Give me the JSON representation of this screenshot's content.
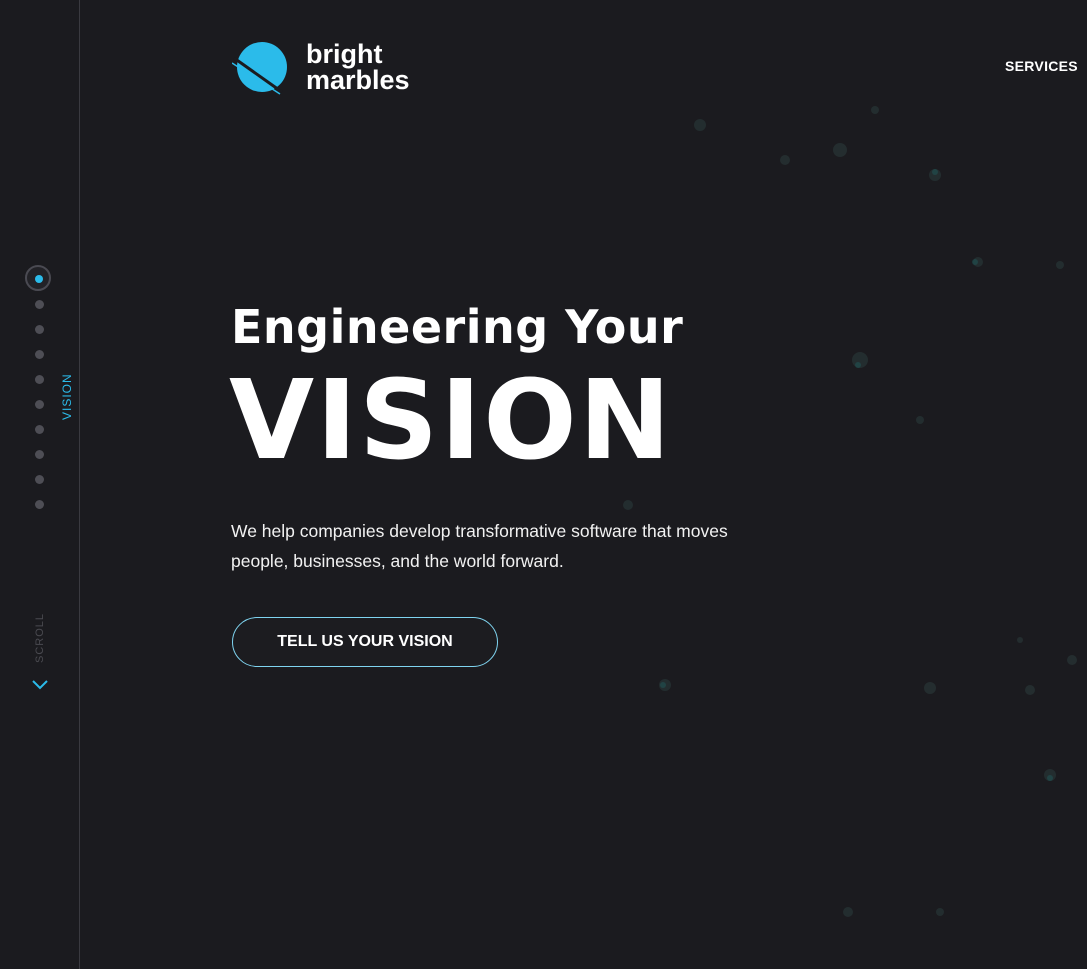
{
  "brand": {
    "line1": "bright",
    "line2": "marbles",
    "accent_color": "#2bbbea"
  },
  "nav": {
    "services_label": "SERVICES"
  },
  "sidebar": {
    "section_label": "VISION",
    "scroll_label": "SCROLL",
    "dot_count": 10,
    "active_dot_index": 0,
    "scroll_icon": "chevron-down-icon"
  },
  "hero": {
    "pre_title": "Engineering Your",
    "title": "VISION",
    "description": "We help companies develop transformative software that moves people, businesses, and the world forward.",
    "cta_label": "TELL US YOUR VISION"
  },
  "colors": {
    "background": "#1b1b1f",
    "text": "#ffffff",
    "accent": "#2bbbea",
    "divider": "#3a3a40"
  }
}
